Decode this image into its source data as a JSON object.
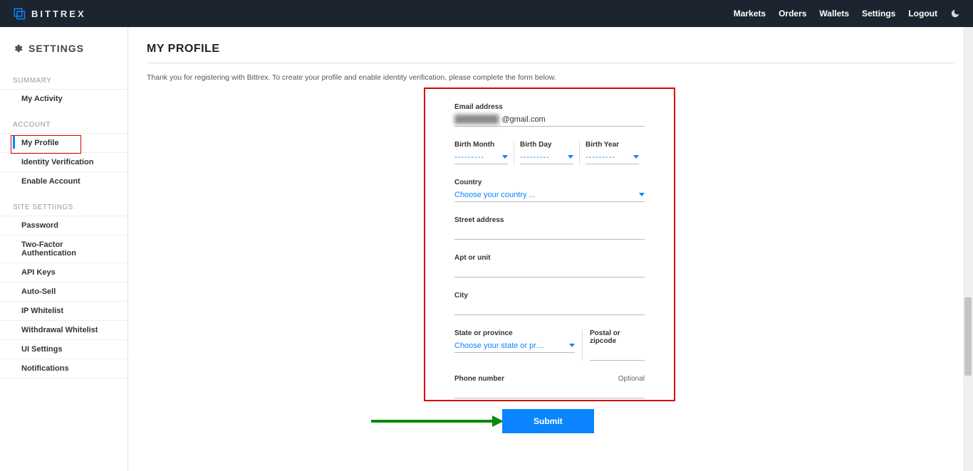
{
  "brand": {
    "name": "BITTREX"
  },
  "topnav": {
    "markets": "Markets",
    "orders": "Orders",
    "wallets": "Wallets",
    "settings": "Settings",
    "logout": "Logout"
  },
  "sidebar": {
    "title": "SETTINGS",
    "groups": {
      "summary": "SUMMARY",
      "account": "ACCOUNT",
      "site": "SITE SETTIINGS"
    },
    "items": {
      "activity": "My Activity",
      "profile": "My Profile",
      "idv": "Identity Verification",
      "enable": "Enable Account",
      "password": "Password",
      "tfa": "Two-Factor Authentication",
      "api": "API Keys",
      "autosell": "Auto-Sell",
      "ipwl": "IP Whitelist",
      "wwl": "Withdrawal Whitelist",
      "uiset": "UI Settings",
      "notif": "Notifications"
    }
  },
  "page": {
    "title": "MY PROFILE",
    "intro": "Thank you for registering with Bittrex. To create your profile and enable identity verification, please complete the form below."
  },
  "form": {
    "labels": {
      "email": "Email address",
      "bmonth": "Birth Month",
      "bday": "Birth Day",
      "byear": "Birth Year",
      "country": "Country",
      "street": "Street address",
      "apt": "Apt or unit",
      "city": "City",
      "state": "State or province",
      "postal": "Postal or zipcode",
      "phone": "Phone number",
      "optional": "Optional"
    },
    "values": {
      "email_masked": "████████",
      "email_suffix": "@gmail.com",
      "dash": "---------",
      "country_ph": "Choose your country ...",
      "state_ph": "Choose your state or province ..."
    },
    "submit": "Submit"
  }
}
